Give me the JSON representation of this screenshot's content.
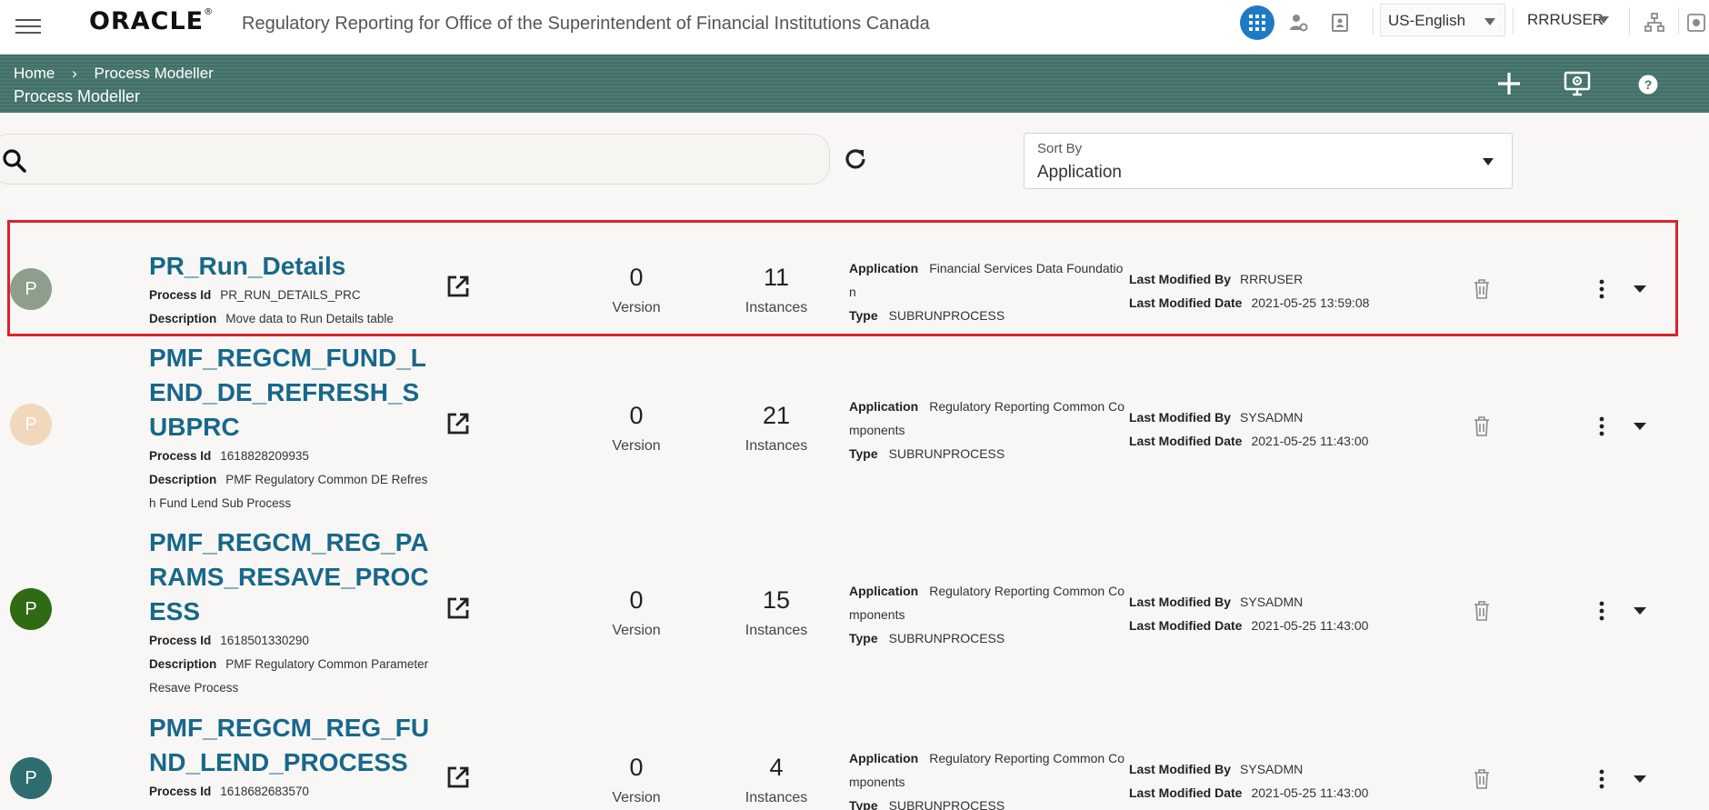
{
  "header": {
    "logo_text": "ORACLE",
    "app_title": "Regulatory Reporting for Office of the Superintendent of Financial Institutions Canada",
    "language": "US-English",
    "user": "RRRUSER"
  },
  "band": {
    "breadcrumb_home": "Home",
    "breadcrumb_current": "Process Modeller",
    "page_title": "Process Modeller"
  },
  "toolbar": {
    "search_placeholder": "",
    "sort_label": "Sort By",
    "sort_value": "Application"
  },
  "labels": {
    "process_id": "Process Id",
    "description": "Description",
    "version": "Version",
    "instances": "Instances",
    "application": "Application",
    "type": "Type",
    "last_modified_by": "Last Modified By",
    "last_modified_date": "Last Modified Date"
  },
  "rows": [
    {
      "avatar": "P",
      "avatar_color": "#8e9e8c",
      "name": "PR_Run_Details",
      "process_id": "PR_RUN_DETAILS_PRC",
      "description": "Move data to Run Details table",
      "version": "0",
      "instances": "11",
      "application": "Financial Services Data Foundation",
      "type": "SUBRUNPROCESS",
      "modified_by": "RRRUSER",
      "modified_date": "2021-05-25 13:59:08",
      "selected": true
    },
    {
      "avatar": "P",
      "avatar_color": "#f1d7bb",
      "name": "PMF_REGCM_FUND_LEND_DE_REFRESH_SUBPRC",
      "process_id": "1618828209935",
      "description": "PMF Regulatory Common DE Refresh Fund Lend Sub Process",
      "version": "0",
      "instances": "21",
      "application": "Regulatory Reporting Common Components",
      "type": "SUBRUNPROCESS",
      "modified_by": "SYSADMN",
      "modified_date": "2021-05-25 11:43:00"
    },
    {
      "avatar": "P",
      "avatar_color": "#2e6b12",
      "name": "PMF_REGCM_REG_PARAMS_RESAVE_PROCESS",
      "process_id": "1618501330290",
      "description": "PMF Regulatory Common Parameter Resave Process",
      "version": "0",
      "instances": "15",
      "application": "Regulatory Reporting Common Components",
      "type": "SUBRUNPROCESS",
      "modified_by": "SYSADMN",
      "modified_date": "2021-05-25 11:43:00"
    },
    {
      "avatar": "P",
      "avatar_color": "#2d6d6f",
      "name": "PMF_REGCM_REG_FUND_LEND_PROCESS",
      "process_id": "1618682683570",
      "description": "",
      "version": "0",
      "instances": "4",
      "application": "Regulatory Reporting Common Components",
      "type": "SUBRUNPROCESS",
      "modified_by": "SYSADMN",
      "modified_date": "2021-05-25 11:43:00"
    }
  ]
}
